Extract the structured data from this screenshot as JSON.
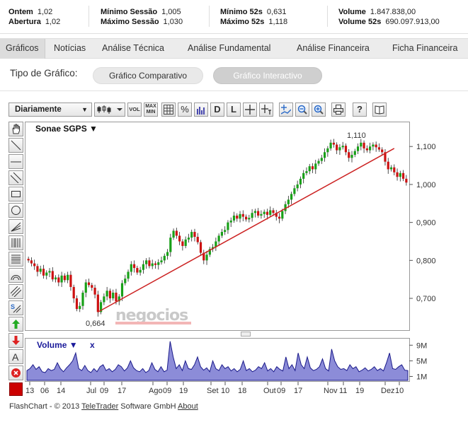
{
  "stats": {
    "ontem_label": "Ontem",
    "ontem_value": "1,02",
    "abertura_label": "Abertura",
    "abertura_value": "1,02",
    "min_sessao_label": "Mínimo Sessão",
    "min_sessao_value": "1,005",
    "max_sessao_label": "Máximo Sessão",
    "max_sessao_value": "1,030",
    "min52_label": "Mínimo 52s",
    "min52_value": "0,631",
    "max52_label": "Máximo 52s",
    "max52_value": "1,118",
    "volume_label": "Volume",
    "volume_value": "1.847.838,00",
    "volume52_label": "Volume 52s",
    "volume52_value": "690.097.913,00"
  },
  "tabs": [
    "Gráficos",
    "Notícias",
    "Análise Técnica",
    "Análise Fundamental",
    "Análise Financeira",
    "Ficha Financeira"
  ],
  "tipo": {
    "label": "Tipo de Gráfico:",
    "comparativo": "Gráfico Comparativo",
    "interactivo": "Gráfico Interactivo"
  },
  "toolbar": {
    "period": "Diariamente",
    "vol": "VOL",
    "max_min_top": "MAX",
    "max_min_bottom": "MIN",
    "percent": "%",
    "d": "D",
    "l": "L"
  },
  "icons": {
    "left_tools": [
      "hand-icon",
      "line-icon",
      "horizontal-line-icon",
      "parallel-lines-icon",
      "rectangle-icon",
      "circle-icon",
      "fan-icon",
      "fibonacci-icon",
      "fibonacci-retracement-icon",
      "arc-icon",
      "channel-icon",
      "speed-lines-icon",
      "arrow-up-icon",
      "arrow-down-icon",
      "text-icon",
      "delete-icon"
    ],
    "color_swatch": "#cc0000"
  },
  "chart": {
    "instrument": "Sonae SGPS ▼",
    "annotation_high": "1,110",
    "annotation_low": "0,664",
    "volume_label": "Volume ▼",
    "volume_close": "x",
    "watermark": "negocios",
    "up_color": "#18a018",
    "down_color": "#cc1111",
    "trend_color": "#cc2222",
    "volume_fill": "#8c8cd8",
    "volume_stroke": "#1a1a8a"
  },
  "chart_data": {
    "type": "candlestick",
    "y_ticks": [
      "1,100",
      "1,000",
      "0,900",
      "0,800",
      "0,700"
    ],
    "ylim": [
      0.62,
      1.16
    ],
    "x_ticks": [
      "13",
      "06",
      "14",
      "Jul",
      "09",
      "17",
      "Ago",
      "09",
      "19",
      "Set",
      "10",
      "18",
      "Out",
      "09",
      "17",
      "Nov",
      "11",
      "19",
      "Dez",
      "10"
    ],
    "volume_ticks": [
      "9M",
      "5M",
      "1M"
    ],
    "close_series": [
      0.8,
      0.792,
      0.785,
      0.77,
      0.778,
      0.76,
      0.768,
      0.772,
      0.75,
      0.755,
      0.742,
      0.76,
      0.748,
      0.762,
      0.73,
      0.7,
      0.672,
      0.68,
      0.715,
      0.742,
      0.735,
      0.728,
      0.71,
      0.664,
      0.69,
      0.705,
      0.72,
      0.7,
      0.715,
      0.692,
      0.705,
      0.74,
      0.752,
      0.77,
      0.79,
      0.78,
      0.768,
      0.775,
      0.79,
      0.8,
      0.785,
      0.792,
      0.788,
      0.795,
      0.8,
      0.812,
      0.822,
      0.86,
      0.878,
      0.865,
      0.85,
      0.838,
      0.855,
      0.86,
      0.875,
      0.862,
      0.848,
      0.82,
      0.8,
      0.815,
      0.83,
      0.835,
      0.85,
      0.865,
      0.875,
      0.88,
      0.9,
      0.905,
      0.918,
      0.91,
      0.922,
      0.915,
      0.908,
      0.912,
      0.925,
      0.93,
      0.918,
      0.922,
      0.928,
      0.92,
      0.932,
      0.925,
      0.915,
      0.91,
      0.93,
      0.948,
      0.96,
      0.975,
      0.99,
      1.0,
      1.015,
      1.03,
      1.035,
      1.048,
      1.04,
      1.055,
      1.062,
      1.07,
      1.085,
      1.095,
      1.11,
      1.105,
      1.09,
      1.098,
      1.102,
      1.085,
      1.07,
      1.078,
      1.088,
      1.1,
      1.11,
      1.095,
      1.09,
      1.1,
      1.105,
      1.098,
      1.092,
      1.085,
      1.06,
      1.04,
      1.045,
      1.032,
      1.02,
      1.03,
      1.015,
      1.005
    ],
    "volume_series_m": [
      2.5,
      3,
      4,
      2.8,
      3.5,
      2.2,
      2,
      3,
      2.5,
      2.8,
      4.5,
      3,
      2.2,
      3.2,
      4,
      5,
      7,
      3,
      2.5,
      3.8,
      2.5,
      2,
      3,
      2.2,
      3.5,
      4,
      2.5,
      3,
      2.2,
      2.8,
      4,
      3.5,
      2.4,
      3.2,
      5,
      3.2,
      2.5,
      2.2,
      3,
      2,
      2.5,
      4.5,
      2.8,
      2.2,
      3.5,
      2.2,
      2.6,
      10,
      6,
      3,
      4,
      2.5,
      5,
      3,
      2.8,
      4,
      6,
      3.5,
      2.6,
      3.2,
      2.2,
      5,
      3,
      2.5,
      4,
      3,
      3.5,
      2.4,
      3,
      2.2,
      2.8,
      5,
      2.5,
      3,
      2.2,
      2.6,
      3.5,
      3,
      4.5,
      2.4,
      3,
      2.2,
      3.5,
      2.8,
      2.4,
      6,
      3,
      4,
      2.5,
      7,
      4,
      3,
      6,
      3.2,
      2.5,
      2.8,
      3.5,
      5.5,
      3,
      2.4,
      8,
      5,
      3.5,
      2.8,
      3,
      2.5,
      4,
      3,
      3.5,
      2.2,
      2.6,
      3.2,
      2.4,
      2.8,
      3.5,
      2.5,
      3,
      2.4,
      4.5,
      7,
      3,
      2.8,
      3.5,
      4,
      2.6,
      2.5
    ],
    "ylim_volume": [
      0,
      10.5
    ],
    "trendline": [
      [
        0.664,
        23
      ],
      [
        1.095,
        121
      ]
    ]
  },
  "footer": {
    "prefix": "FlashChart - © 2013 ",
    "company": "TeleTrader",
    "middle": " Software GmbH ",
    "about": "About"
  }
}
